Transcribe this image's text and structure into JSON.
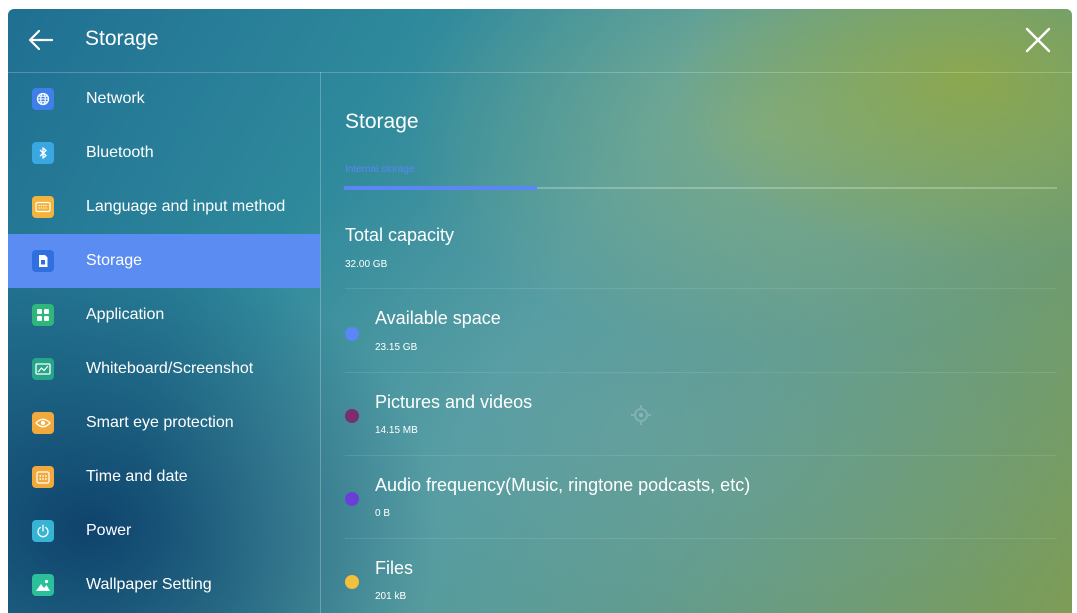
{
  "header": {
    "title": "Storage"
  },
  "sidebar": {
    "items": [
      {
        "label": "Network",
        "icon": "globe-icon",
        "color": "#3f7fe9"
      },
      {
        "label": "Bluetooth",
        "icon": "bluetooth-icon",
        "color": "#3aa7e0"
      },
      {
        "label": "Language and input method",
        "icon": "keyboard-icon",
        "color": "#f2b43c"
      },
      {
        "label": "Storage",
        "icon": "storage-icon",
        "color": "#3f7fe9",
        "active": true
      },
      {
        "label": "Application",
        "icon": "apps-grid-icon",
        "color": "#2fb67a"
      },
      {
        "label": "Whiteboard/Screenshot",
        "icon": "whiteboard-icon",
        "color": "#27a58a"
      },
      {
        "label": "Smart eye protection",
        "icon": "eye-icon",
        "color": "#f2a93c"
      },
      {
        "label": "Time and date",
        "icon": "calendar-icon",
        "color": "#f2a93c"
      },
      {
        "label": "Power",
        "icon": "power-icon",
        "color": "#37b4d4"
      },
      {
        "label": "Wallpaper Setting",
        "icon": "image-icon",
        "color": "#2bbf9a"
      }
    ]
  },
  "main": {
    "title": "Storage",
    "tab": {
      "label": "Internal storage",
      "accent": "#5b86f5"
    },
    "total": {
      "label": "Total capacity",
      "value": "32.00 GB"
    },
    "categories": [
      {
        "label": "Available space",
        "value": "23.15 GB",
        "color": "#5b86f5"
      },
      {
        "label": "Pictures and videos",
        "value": "14.15 MB",
        "color": "#7a2e6e"
      },
      {
        "label": "Audio frequency(Music, ringtone podcasts, etc)",
        "value": "0 B",
        "color": "#6a3fd6"
      },
      {
        "label": "Files",
        "value": "201 kB",
        "color": "#f2c03a"
      }
    ]
  }
}
